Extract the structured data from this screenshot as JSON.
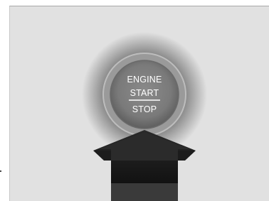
{
  "button": {
    "line1": "ENGINE",
    "line2": "START",
    "line3": "STOP"
  },
  "icons": {
    "button": "engine-start-stop-button-icon",
    "arrow": "up-arrow-icon"
  },
  "colors": {
    "panel": "#e1e1e1",
    "ring_outer": "#8c8c8c",
    "ring_inner": "#5a5a5a",
    "arrow": "#111111",
    "text": "#ffffff"
  }
}
